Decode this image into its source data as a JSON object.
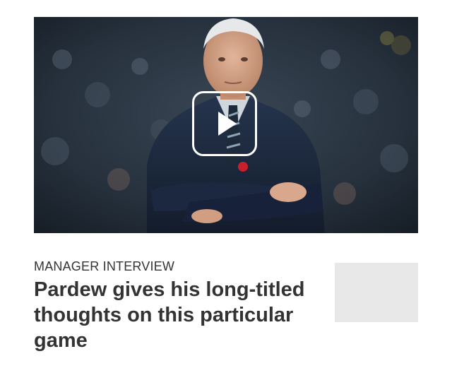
{
  "video": {
    "subject": "Pardew",
    "play_icon": "play-icon"
  },
  "article": {
    "category": "MANAGER INTERVIEW",
    "headline": "Pardew gives his long-titled thoughts on this particular game"
  },
  "colors": {
    "text": "#333333",
    "thumbnail_placeholder": "#e8e8e8",
    "play_outline": "#ffffff"
  }
}
